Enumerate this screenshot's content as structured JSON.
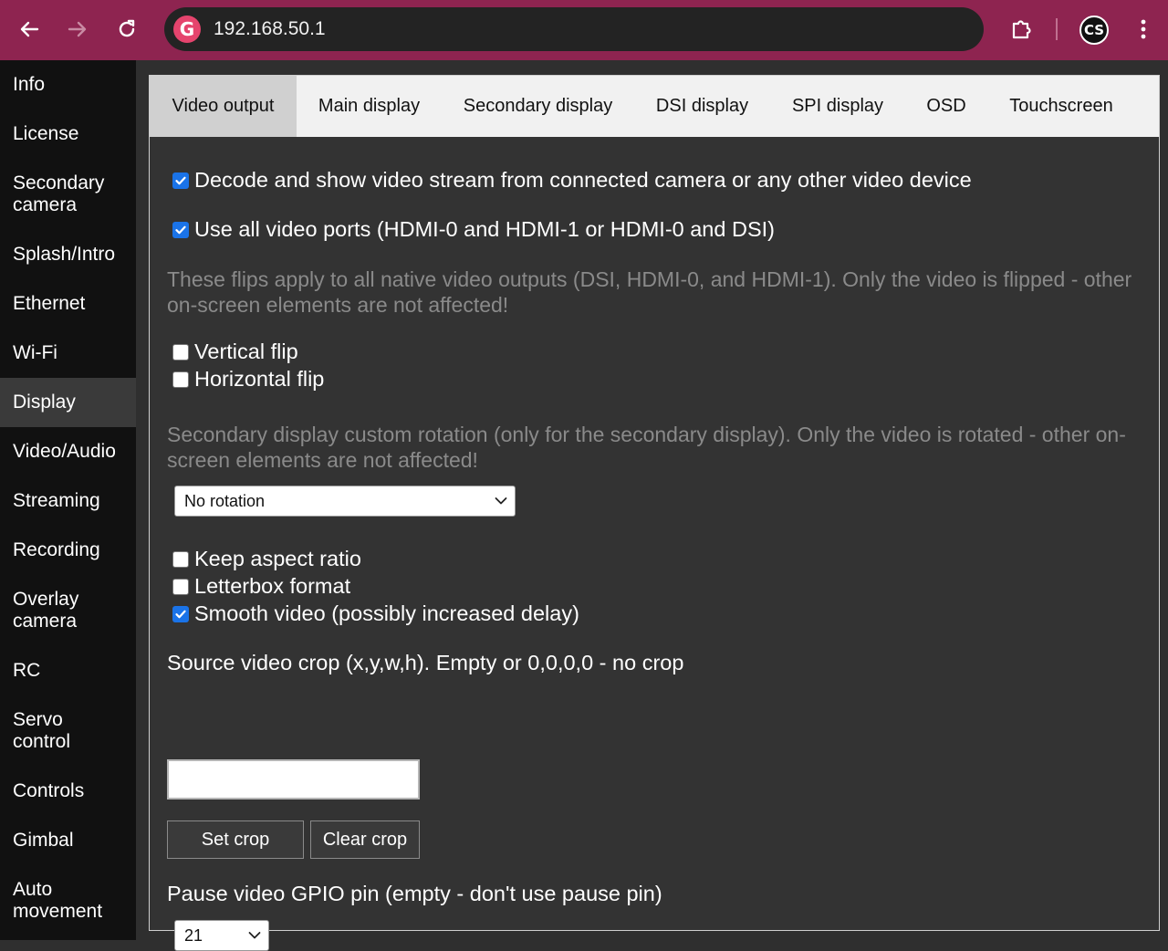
{
  "browser": {
    "url": "192.168.50.1",
    "profile_initials": "CS",
    "logo_letter": "G"
  },
  "sidebar": {
    "items": [
      {
        "label": "Info"
      },
      {
        "label": "License"
      },
      {
        "label": "Secondary camera"
      },
      {
        "label": "Splash/Intro"
      },
      {
        "label": "Ethernet"
      },
      {
        "label": "Wi-Fi"
      },
      {
        "label": "Display",
        "active": true
      },
      {
        "label": "Video/Audio"
      },
      {
        "label": "Streaming"
      },
      {
        "label": "Recording"
      },
      {
        "label": "Overlay camera"
      },
      {
        "label": "RC"
      },
      {
        "label": "Servo control"
      },
      {
        "label": "Controls"
      },
      {
        "label": "Gimbal"
      },
      {
        "label": "Auto movement"
      }
    ]
  },
  "tabs": [
    {
      "label": "Video output",
      "active": true
    },
    {
      "label": "Main display"
    },
    {
      "label": "Secondary display"
    },
    {
      "label": "DSI display"
    },
    {
      "label": "SPI display"
    },
    {
      "label": "OSD"
    },
    {
      "label": "Touchscreen"
    }
  ],
  "video_output": {
    "decode_stream": {
      "label": "Decode and show video stream from connected camera or any other video device",
      "checked": true
    },
    "all_ports": {
      "label": "Use all video ports (HDMI-0 and HDMI-1 or HDMI-0 and DSI)",
      "checked": true
    },
    "flip_note": "These flips apply to all native video outputs (DSI, HDMI-0, and HDMI-1). Only the video is flipped - other on-screen elements are not affected!",
    "vertical_flip": {
      "label": "Vertical flip",
      "checked": false
    },
    "horizontal_flip": {
      "label": "Horizontal flip",
      "checked": false
    },
    "rotation_note": "Secondary display custom rotation (only for the secondary display). Only the video is rotated - other on-screen elements are not affected!",
    "rotation_select": {
      "value": "No rotation"
    },
    "keep_aspect": {
      "label": "Keep aspect ratio",
      "checked": false
    },
    "letterbox": {
      "label": "Letterbox format",
      "checked": false
    },
    "smooth_video": {
      "label": "Smooth video (possibly increased delay)",
      "checked": true
    },
    "crop_label": "Source video crop (x,y,w,h). Empty or 0,0,0,0 - no crop",
    "crop_value": "",
    "set_crop_label": "Set crop",
    "clear_crop_label": "Clear crop",
    "pause_label": "Pause video GPIO pin (empty - don't use pause pin)",
    "pause_select": {
      "value": "21"
    }
  },
  "colors": {
    "chrome": "#8e2450",
    "checkbox_on": "#1a73e8",
    "sidebar_bg": "#111111",
    "panel_bg": "#333333"
  }
}
